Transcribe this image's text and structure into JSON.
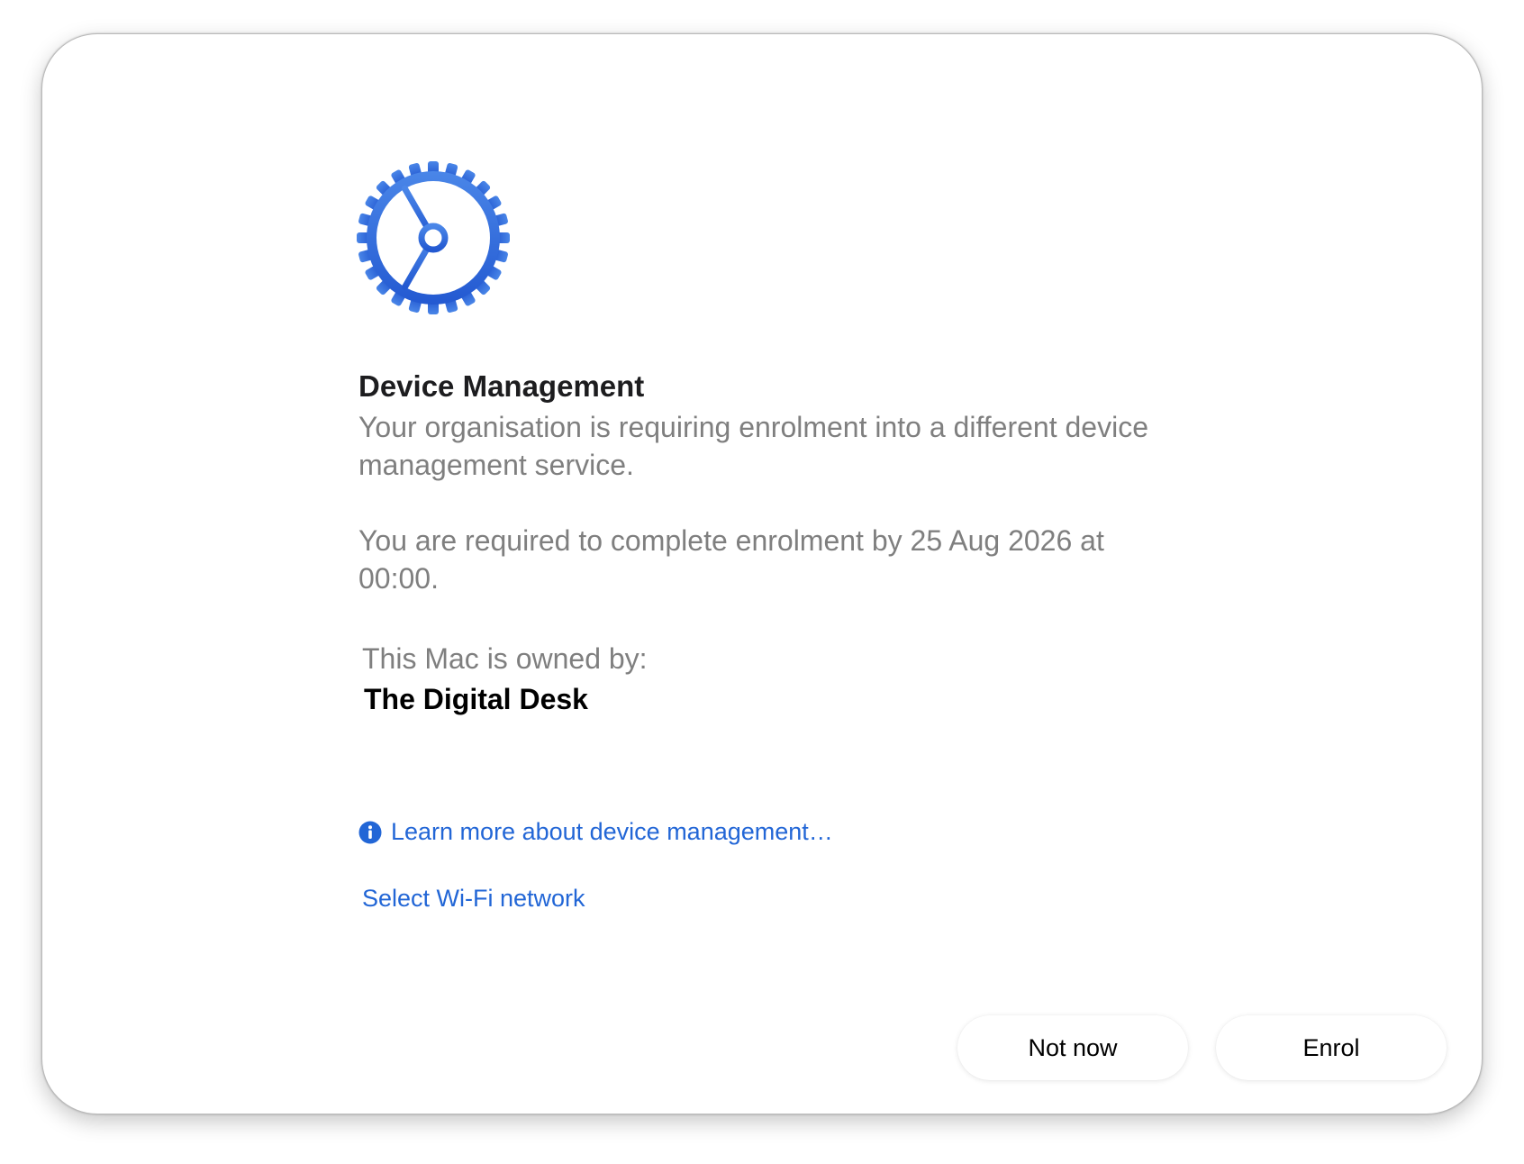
{
  "dialog": {
    "icon": "gear-icon",
    "title": "Device Management",
    "description": "Your organisation is requiring enrolment into a different device management service.",
    "deadline_text": "You are required to complete enrolment by 25 Aug 2026 at 00:00.",
    "owned_by_label": "This Mac is owned by:",
    "owner_name": "The Digital Desk",
    "learn_more": {
      "icon": "info-icon",
      "label": "Learn more about device management…"
    },
    "wifi_link_label": "Select Wi-Fi network",
    "buttons": {
      "not_now": "Not now",
      "enrol": "Enrol"
    }
  },
  "colors": {
    "accent": "#2266d6",
    "icon_blue": "#2f6fdc",
    "secondary_text": "#7f7f7f",
    "primary_text": "#1d1d1f"
  }
}
